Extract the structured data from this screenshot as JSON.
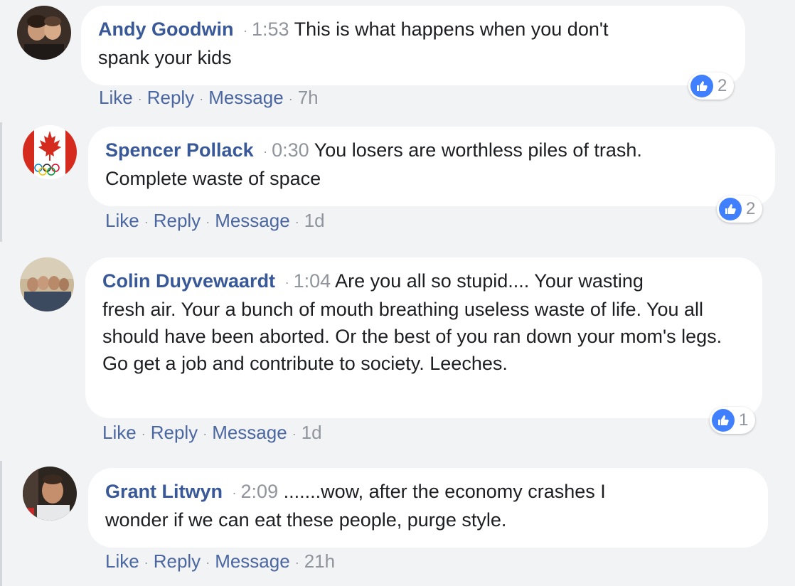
{
  "comments": [
    {
      "author": "Andy Goodwin",
      "time": "1:53",
      "text_line1": "This is what happens when you don't",
      "text_rest": "spank your kids",
      "like_label": "Like",
      "reply_label": "Reply",
      "message_label": "Message",
      "age": "7h",
      "reactions": "2"
    },
    {
      "author": "Spencer Pollack",
      "time": "0:30",
      "text_line1": "You losers are worthless piles of trash.",
      "text_rest": "Complete waste of space",
      "like_label": "Like",
      "reply_label": "Reply",
      "message_label": "Message",
      "age": "1d",
      "reactions": "2"
    },
    {
      "author": "Colin Duyvewaardt",
      "time": "1:04",
      "text_line1": "Are you all so stupid.... Your wasting",
      "text_rest": "fresh air. Your a bunch of mouth breathing useless waste of life. You all should have been aborted. Or the best of you ran down your mom's legs. Go get a job and contribute to society. Leeches.",
      "like_label": "Like",
      "reply_label": "Reply",
      "message_label": "Message",
      "age": "1d",
      "reactions": "1"
    },
    {
      "author": "Grant Litwyn",
      "time": "2:09",
      "text_line1": ".......wow, after the economy crashes I",
      "text_rest": "wonder if we can eat these people, purge style.",
      "like_label": "Like",
      "reply_label": "Reply",
      "message_label": "Message",
      "age": "21h",
      "reactions": ""
    }
  ],
  "colors": {
    "background": "#f2f3f5",
    "author": "#385898",
    "action_link": "#4b67a1",
    "meta_gray": "#90949c",
    "like_blue": "#4080ff"
  }
}
